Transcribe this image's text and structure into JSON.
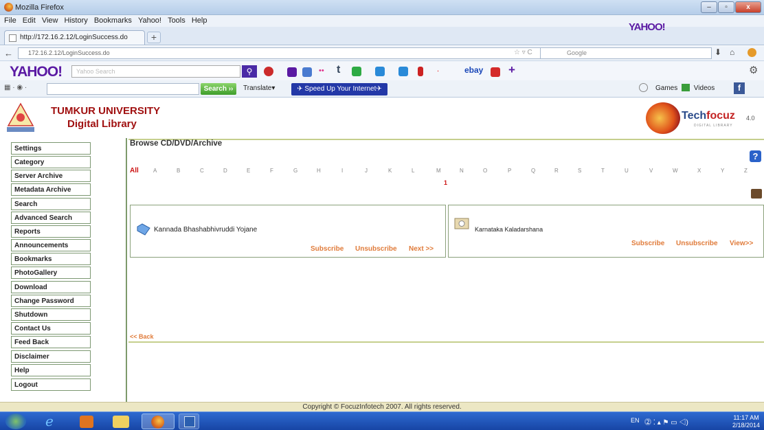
{
  "window": {
    "title": "Mozilla Firefox",
    "min": "–",
    "max": "▫",
    "close": "x"
  },
  "menu": [
    "File",
    "Edit",
    "View",
    "History",
    "Bookmarks",
    "Yahoo!",
    "Tools",
    "Help"
  ],
  "tab": {
    "label": "http://172.16.2.12/LoginSuccess.do",
    "newtab": "+"
  },
  "yahoo_right": "YAHOO!",
  "nav": {
    "url": "172.16.2.12/LoginSuccess.do",
    "search_placeholder": "Google"
  },
  "yahoobar": {
    "logo": "YAHOO!",
    "search_placeholder": "Yahoo Search",
    "ebay": "ebay"
  },
  "toolbar2": {
    "search": "Search ››",
    "translate": "Translate▾",
    "speedup": "✈ Speed Up Your Internet✈",
    "games": "Games",
    "videos": "Videos"
  },
  "header": {
    "university": "TUMKUR UNIVERSITY",
    "library": "Digital Library",
    "brand_a": "Tech",
    "brand_b": "focuz",
    "version": "4.0",
    "brand_sub": "DIGITAL LIBRARY"
  },
  "sidebar": {
    "items": [
      "Settings",
      "Category",
      "Server Archive",
      "Metadata Archive",
      "Search",
      "Advanced Search",
      "Reports",
      "Announcements",
      "Bookmarks",
      "PhotoGallery",
      "Download",
      "Change Password",
      "Shutdown",
      "Contact Us",
      "Feed Back",
      "Disclaimer",
      "Help",
      "Logout"
    ]
  },
  "main": {
    "heading": "Browse CD/DVD/Archive",
    "help": "?",
    "alphabet": [
      "All",
      "A",
      "B",
      "C",
      "D",
      "E",
      "F",
      "G",
      "H",
      "I",
      "J",
      "K",
      "L",
      "M",
      "N",
      "O",
      "P",
      "Q",
      "R",
      "S",
      "T",
      "U",
      "V",
      "W",
      "X",
      "Y",
      "Z"
    ],
    "m_count": "1",
    "cards": [
      {
        "title": "Kannada Bhashabhivruddi Yojane",
        "subscribe": "Subscribe",
        "unsubscribe": "Unsubscribe",
        "next": "Next >>"
      },
      {
        "title": "Karnataka Kaladarshana",
        "subscribe": "Subscribe",
        "unsubscribe": "Unsubscribe",
        "next": "View>>"
      }
    ],
    "back": "<< Back"
  },
  "footer": "Copyright © FocuzInfotech 2007. All rights reserved.",
  "taskbar": {
    "lang": "EN",
    "time": "11:17 AM",
    "date": "2/18/2014"
  },
  "colors": {
    "accent_red": "#a01010",
    "link_orange": "#e07b3a",
    "border_green": "#7b9770"
  }
}
